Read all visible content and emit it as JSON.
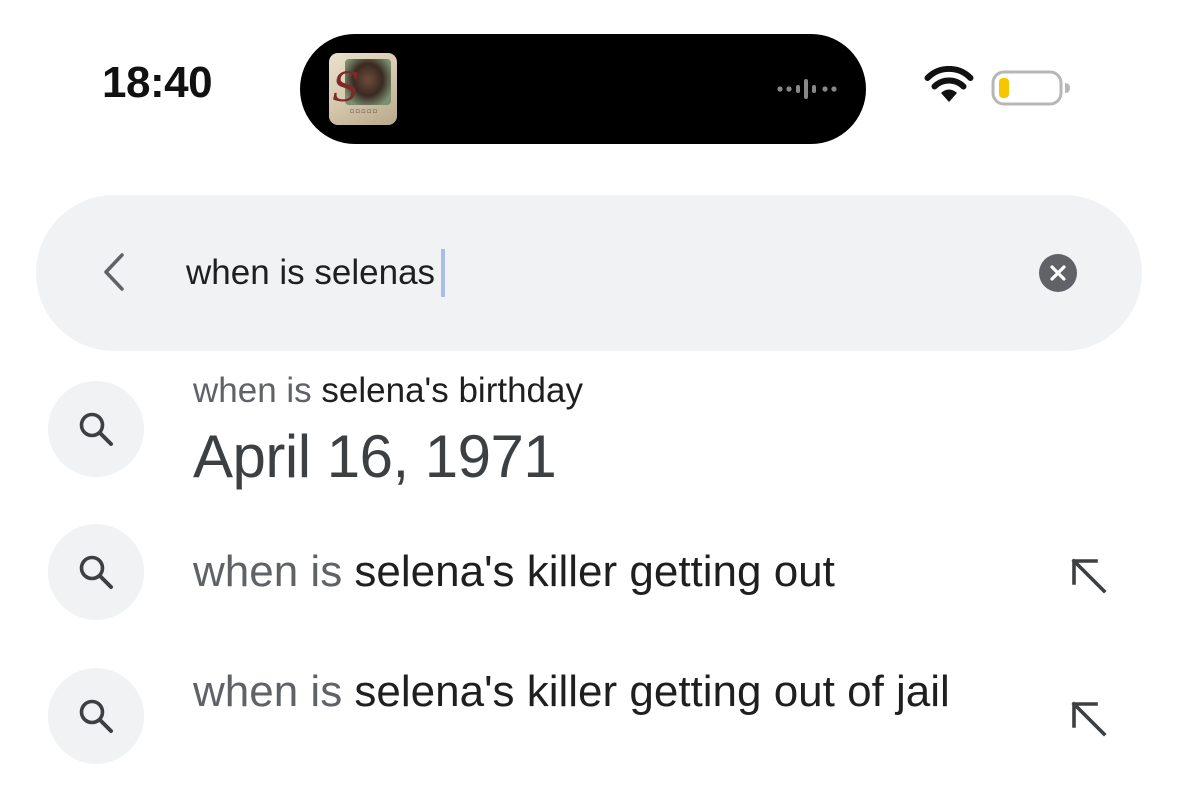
{
  "status_bar": {
    "time": "18:40",
    "battery_color": "#f7c600",
    "icons": [
      "album-art-icon",
      "waveform-icon",
      "wifi-icon",
      "battery-icon"
    ]
  },
  "search": {
    "query": "when is selenas",
    "back_icon": "chevron-left-icon",
    "clear_icon": "clear-icon"
  },
  "suggestions": [
    {
      "prefix": "when is ",
      "rest": "selena's birthday",
      "answer": "April 16, 1971",
      "icon": "search-icon"
    },
    {
      "prefix": "when is ",
      "rest": "selena's killer getting out",
      "icon": "search-icon",
      "action_icon": "fill-query-arrow-icon"
    },
    {
      "prefix": "when is ",
      "rest": "selena's killer getting out of jail",
      "icon": "search-icon",
      "action_icon": "fill-query-arrow-icon"
    }
  ],
  "colors": {
    "pill_background": "#f0f2f4",
    "muted_text": "#5f6368",
    "caret": "#a8bde8"
  }
}
